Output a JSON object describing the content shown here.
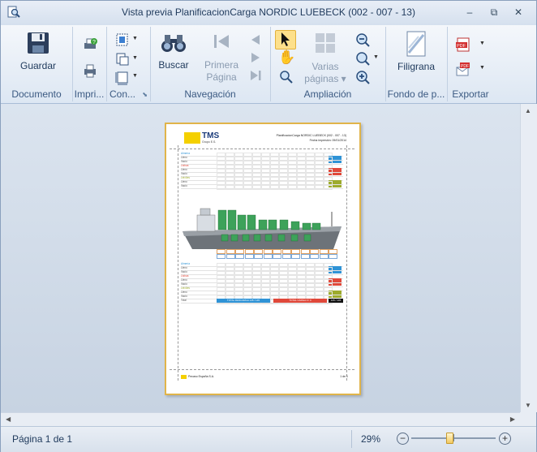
{
  "window": {
    "title": "Vista previa PlanificacionCarga NORDIC LUEBECK (002 - 007 - 13)",
    "minimize_glyph": "–",
    "restore_glyph": "⧉",
    "close_glyph": "✕"
  },
  "ribbon": {
    "groups": {
      "documento": {
        "label": "Documento",
        "save_label": "Guardar"
      },
      "imprimir": {
        "label": "Impri..."
      },
      "configurar": {
        "label": "Con..."
      },
      "navegacion": {
        "label": "Navegación",
        "search_label": "Buscar",
        "first_page_line1": "Primera",
        "first_page_line2": "Página"
      },
      "ampliacion": {
        "label": "Ampliación",
        "multi_pages_line1": "Varias",
        "multi_pages_line2": "páginas"
      },
      "fondo": {
        "label": "Fondo de p...",
        "watermark_label": "Filigrana"
      },
      "exportar": {
        "label": "Exportar"
      }
    }
  },
  "preview_page": {
    "logo_text": "TMS",
    "logo_sub": "Grupo E.S.",
    "header_line1": "PlanificacionCarga NORDIC LUEBECK (002 - 007 - 13)",
    "header_line2": "Fecha impresión: 09/01/2014",
    "row_labels_top": [
      "Almería",
      "Lleno",
      "Vacío",
      "Lisboa",
      "Lleno",
      "Vacío",
      "Leixões",
      "Lleno",
      "Vacío"
    ],
    "row_labels_bottom": [
      "Almería",
      "Lleno",
      "Vacío",
      "Lisboa",
      "Lleno",
      "Vacío",
      "Leixões",
      "Lleno",
      "Vacío",
      "Total"
    ],
    "total_desc": "TOTAL DESCARGA 145 / 145",
    "total_carga": "TOTAL CARGA 0 / 0",
    "total_sum": "145 / 145",
    "footer_company": "Pecaso España S.A.",
    "footer_page": "1 de 1",
    "colors": {
      "blue": "#2f93d6",
      "red": "#e0483a",
      "green": "#8cc63e",
      "olive": "#9dab2d"
    }
  },
  "status": {
    "page_info": "Página 1 de 1",
    "zoom": "29%",
    "zoom_out_glyph": "−",
    "zoom_in_glyph": "+",
    "zoom_level": 0.45
  }
}
